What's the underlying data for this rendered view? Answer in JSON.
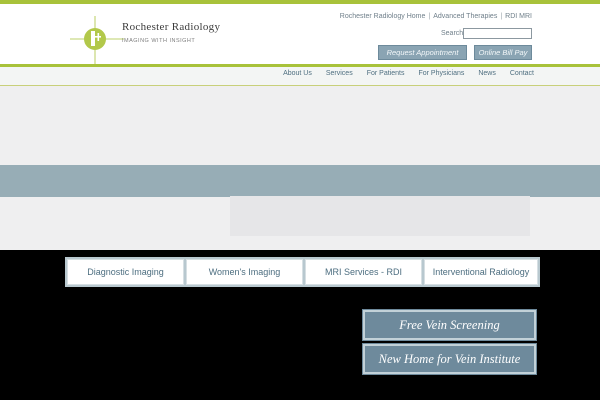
{
  "brand": {
    "name": "Rochester Radiology",
    "tagline": "IMAGING WITH INSIGHT",
    "accent_color": "#a8c23a",
    "logo_icon": "radiology-cross-logo-icon"
  },
  "utility_links": [
    "Rochester Radiology Home",
    "Advanced Therapies",
    "RDI MRI"
  ],
  "search": {
    "label": "Search:",
    "value": "",
    "placeholder": ""
  },
  "header_buttons": {
    "request": "Request Appointment",
    "bill_pay": "Online Bill Pay"
  },
  "nav": [
    "About Us",
    "Services",
    "For Patients",
    "For Physicians",
    "News",
    "Contact"
  ],
  "service_tabs": [
    "Diagnostic Imaging",
    "Women's Imaging",
    "MRI Services - RDI",
    "Interventional Radiology"
  ],
  "promos": [
    "Free Vein Screening",
    "New Home for Vein Institute"
  ],
  "colors": {
    "nav_text": "#4f6f80",
    "promo_bg": "#6e8a9c",
    "hero_band": "#97adb6"
  }
}
